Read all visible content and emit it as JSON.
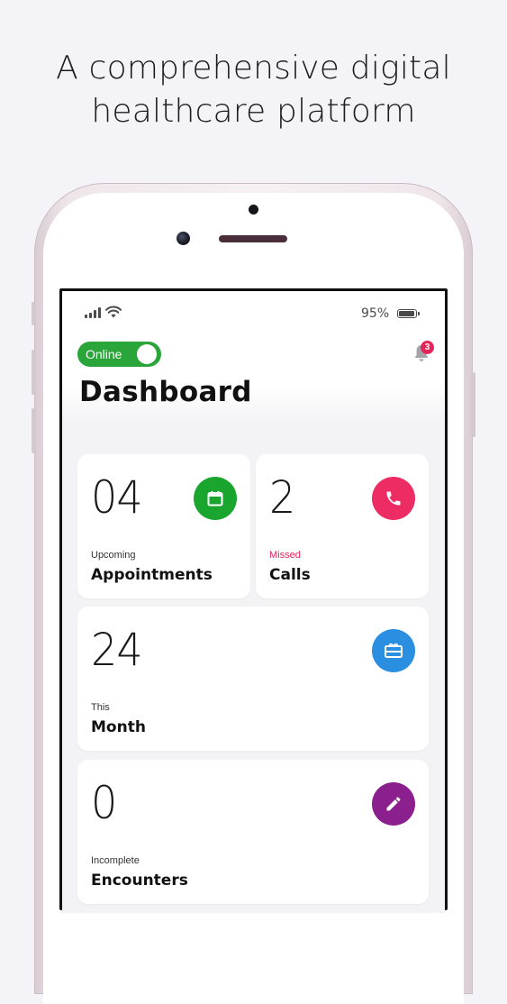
{
  "headline": {
    "line1": "A comprehensive digital",
    "line2": "healthcare platform"
  },
  "status_bar": {
    "battery_text": "95%",
    "battery_level": 0.95
  },
  "header": {
    "online_label": "Online",
    "online_on": true,
    "notification_count": "3",
    "title": "Dashboard"
  },
  "cards": [
    {
      "value": "04",
      "sub_label": "Upcoming",
      "label": "Appointments",
      "icon": "calendar-icon",
      "icon_color": "#1aa52e"
    },
    {
      "value": "2",
      "sub_label": "Missed",
      "label": "Calls",
      "icon": "phone-icon",
      "icon_color": "#ec2c62",
      "sub_label_color": "#e0245e"
    },
    {
      "value": "24",
      "sub_label": "This",
      "label": "Month",
      "icon": "gift-card-icon",
      "icon_color": "#2a8fe0"
    },
    {
      "value": "0",
      "sub_label": "Incomplete",
      "label": "Encounters",
      "icon": "pencil-icon",
      "icon_color": "#8c1f8e"
    }
  ],
  "colors": {
    "background": "#f4f4f8",
    "online_green": "#2aa53a",
    "badge_red": "#e5245a"
  }
}
